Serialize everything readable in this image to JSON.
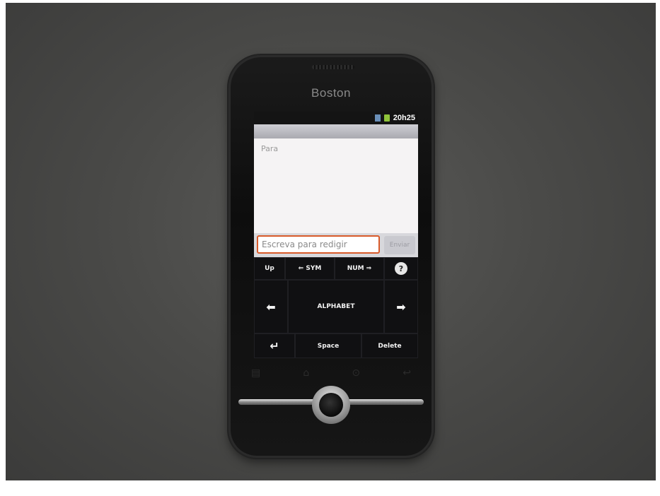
{
  "device": {
    "brand": "Boston"
  },
  "status_bar": {
    "time": "20h25",
    "icons": [
      "network-icon",
      "battery-icon"
    ]
  },
  "compose": {
    "to_placeholder": "Para",
    "message_placeholder": "Escreva para redigir",
    "send_label": "Enviar"
  },
  "keyboard": {
    "row1": {
      "up": "Up",
      "sym": "⇐ SYM",
      "num": "NUM ⇒",
      "help": "?"
    },
    "row2": {
      "left": "⬅",
      "center": "ALPHABET",
      "right": "➡"
    },
    "row3": {
      "enter": "↵",
      "space": "Space",
      "delete": "Delete"
    }
  },
  "nav_keys": {
    "menu": "▤",
    "home": "⌂",
    "search": "⊙",
    "back": "↩"
  },
  "colors": {
    "accent_border": "#d85a2a",
    "battery": "#8fc33a",
    "network": "#6a8fb8"
  }
}
